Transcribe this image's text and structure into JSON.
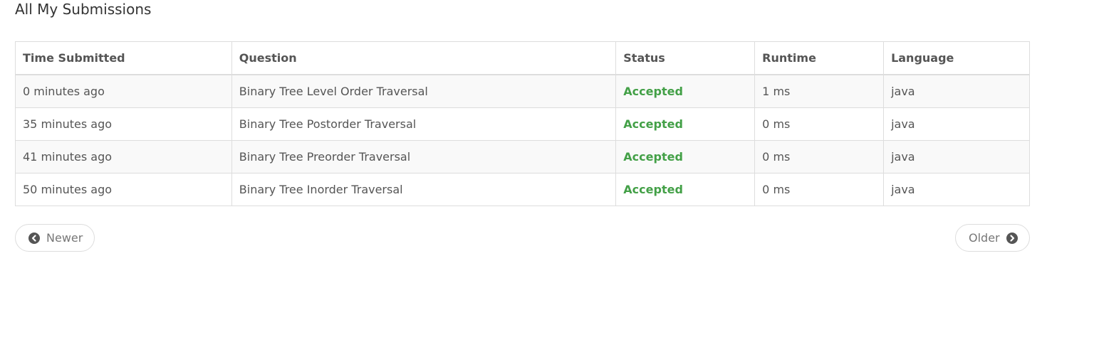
{
  "page": {
    "title": "All My Submissions"
  },
  "table": {
    "headers": [
      "Time Submitted",
      "Question",
      "Status",
      "Runtime",
      "Language"
    ],
    "rows": [
      {
        "time": "0 minutes ago",
        "question": "Binary Tree Level Order Traversal",
        "status": "Accepted",
        "runtime": "1 ms",
        "language": "java"
      },
      {
        "time": "35 minutes ago",
        "question": "Binary Tree Postorder Traversal",
        "status": "Accepted",
        "runtime": "0 ms",
        "language": "java"
      },
      {
        "time": "41 minutes ago",
        "question": "Binary Tree Preorder Traversal",
        "status": "Accepted",
        "runtime": "0 ms",
        "language": "java"
      },
      {
        "time": "50 minutes ago",
        "question": "Binary Tree Inorder Traversal",
        "status": "Accepted",
        "runtime": "0 ms",
        "language": "java"
      }
    ]
  },
  "pager": {
    "newer_label": "Newer",
    "newer_icon": "chevron-left-circle-icon",
    "older_label": "Older",
    "older_icon": "chevron-right-circle-icon"
  },
  "colors": {
    "accepted": "#43a047",
    "header_text": "#555555",
    "border": "#dddddd",
    "stripe": "#f9f9f9"
  }
}
